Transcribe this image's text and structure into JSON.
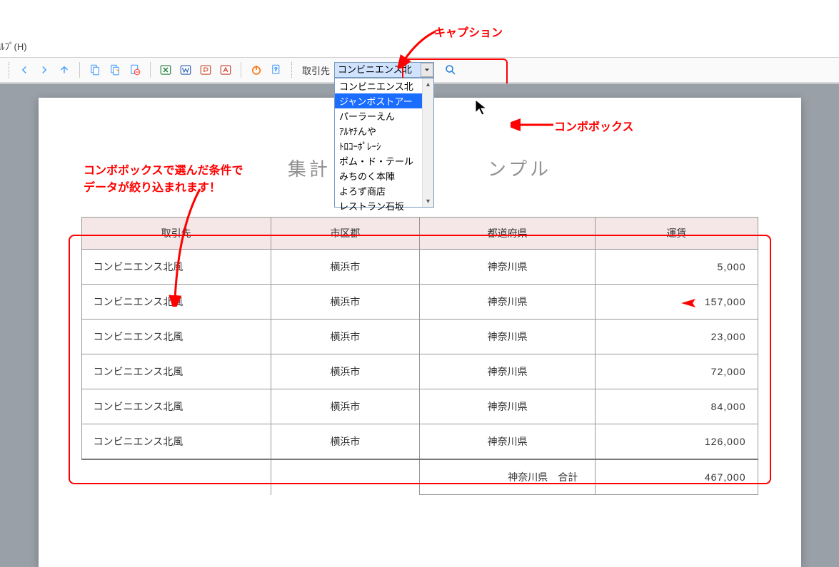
{
  "menu_fragment": "ﾙﾌﾟ(H)",
  "toolbar": {
    "combo_label": "取引先",
    "combo_value": "コンビニエンス北",
    "combo_items": [
      "コンビニエンス北",
      "ジャンボストアー",
      "パーラーえん",
      "ｱﾙﾔﾁんや",
      "ﾄﾛｺｰﾎﾟﾚｰｼ",
      "ポム・ド・テール",
      "みちのく本陣",
      "よろず商店",
      "レストラン石坂"
    ],
    "combo_highlight_index": 1
  },
  "annotations": {
    "caption": "キャプション",
    "combobox": "コンボボックス",
    "filter_msg_1": "コンボボックスで選んだ条件で",
    "filter_msg_2": "データが絞り込まれます！"
  },
  "report": {
    "title_left": "集計レ",
    "title_right": "ンプル",
    "headers": [
      "取引先",
      "市区郡",
      "都道府県",
      "運賃"
    ],
    "rows": [
      [
        "コンビニエンス北風",
        "横浜市",
        "神奈川県",
        "5,000"
      ],
      [
        "コンビニエンス北風",
        "横浜市",
        "神奈川県",
        "157,000"
      ],
      [
        "コンビニエンス北風",
        "横浜市",
        "神奈川県",
        "23,000"
      ],
      [
        "コンビニエンス北風",
        "横浜市",
        "神奈川県",
        "72,000"
      ],
      [
        "コンビニエンス北風",
        "横浜市",
        "神奈川県",
        "84,000"
      ],
      [
        "コンビニエンス北風",
        "横浜市",
        "神奈川県",
        "126,000"
      ]
    ],
    "total_label": "神奈川県　合計",
    "total_value": "467,000"
  }
}
